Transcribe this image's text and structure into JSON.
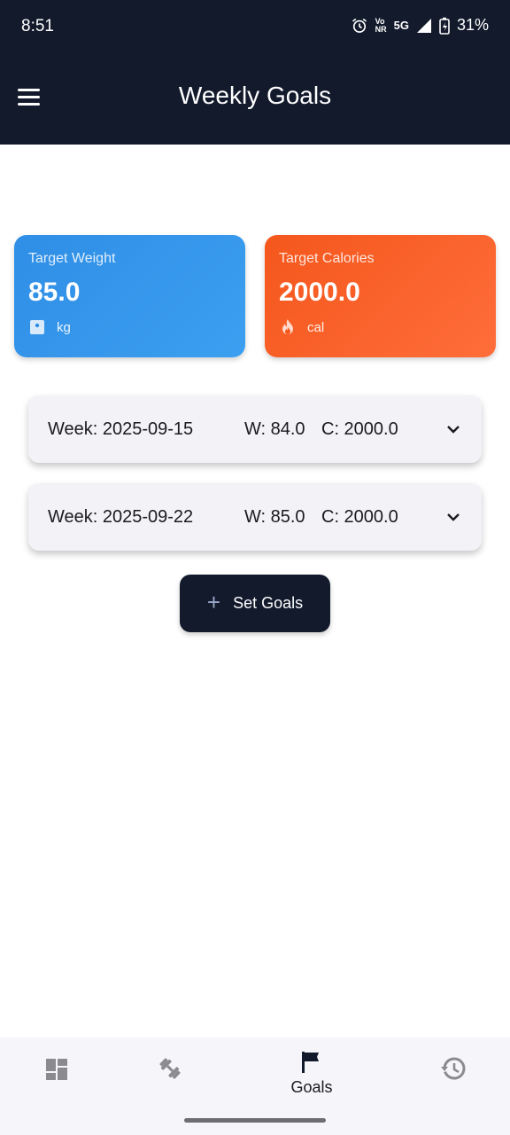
{
  "status_bar": {
    "time": "8:51",
    "network_top": "Vo",
    "network_bottom": "NR",
    "network_5g": "5G",
    "battery": "31%"
  },
  "app_bar": {
    "title": "Weekly Goals"
  },
  "cards": {
    "weight": {
      "label": "Target Weight",
      "value": "85.0",
      "unit": "kg",
      "color": "#2f8ee6"
    },
    "calories": {
      "label": "Target Calories",
      "value": "2000.0",
      "unit": "cal",
      "color": "#f4571c"
    }
  },
  "weeks": [
    {
      "week": "Week: 2025-09-15",
      "weight": "W: 84.0",
      "calories": "C: 2000.0"
    },
    {
      "week": "Week: 2025-09-22",
      "weight": "W: 85.0",
      "calories": "C: 2000.0"
    }
  ],
  "actions": {
    "set_goals": "Set Goals"
  },
  "bottom_nav": {
    "items": [
      {
        "icon": "dashboard-icon",
        "label": ""
      },
      {
        "icon": "fitness-icon",
        "label": ""
      },
      {
        "icon": "flag-icon",
        "label": "Goals"
      },
      {
        "icon": "history-icon",
        "label": ""
      }
    ]
  },
  "colors": {
    "primary": "#121a2c",
    "surface": "#f2f2f7"
  }
}
